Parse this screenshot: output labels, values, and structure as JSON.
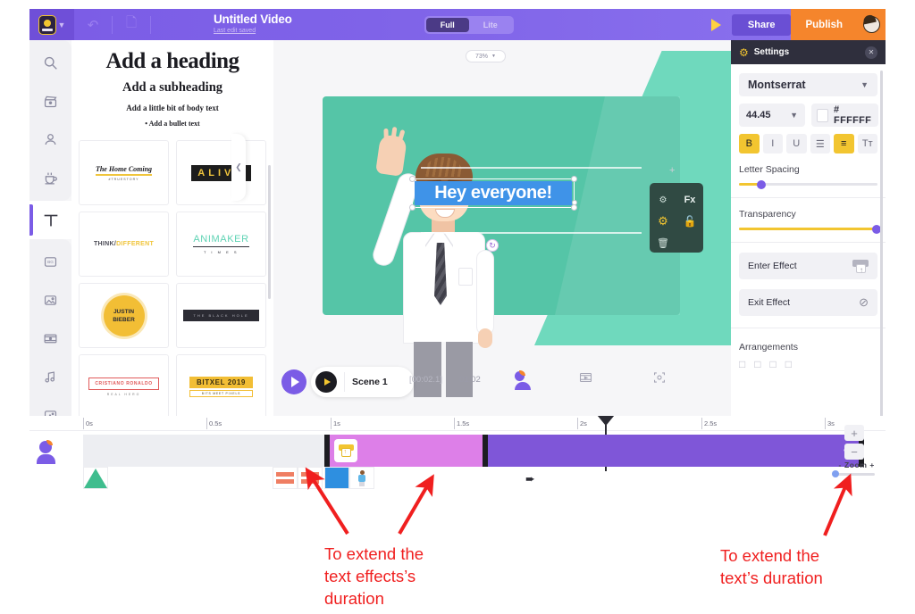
{
  "topbar": {
    "logo": "animaker-logo",
    "undo_icon": "undo-icon",
    "copy_icon": "copy-icon",
    "title": "Untitled Video",
    "subtitle": "Last edit saved",
    "mode_full": "Full",
    "mode_lite": "Lite",
    "preview_icon": "play-icon",
    "share_label": "Share",
    "publish_label": "Publish",
    "avatar": "user-avatar"
  },
  "rail": {
    "items": [
      {
        "name": "search",
        "icon": "search-icon"
      },
      {
        "name": "video",
        "icon": "clapperboard-icon"
      },
      {
        "name": "character",
        "icon": "person-icon"
      },
      {
        "name": "props",
        "icon": "props-icon"
      },
      {
        "name": "text",
        "icon": "text-t-icon",
        "active": true
      },
      {
        "name": "background",
        "icon": "bg-icon"
      },
      {
        "name": "image",
        "icon": "image-icon"
      },
      {
        "name": "video-clip",
        "icon": "film-icon"
      },
      {
        "name": "music",
        "icon": "music-note-icon"
      },
      {
        "name": "effects",
        "icon": "sparkle-icon"
      },
      {
        "name": "upload",
        "icon": "upload-icon"
      }
    ]
  },
  "text_panel": {
    "heading": "Add a heading",
    "subheading": "Add a subheading",
    "body": "Add a little bit of body text",
    "bullet": "Add a bullet text",
    "collapse_icon": "chevron-left-icon",
    "templates": [
      {
        "id": "home-coming",
        "title": "The Home Coming",
        "sub": "#TRUESTORY"
      },
      {
        "id": "alive",
        "title": "ALIVE",
        "sub": ""
      },
      {
        "id": "think-different",
        "title": "THINK/",
        "title2": "DIFFERENT",
        "sub": ""
      },
      {
        "id": "animaker-times",
        "title": "ANIMAKER",
        "sub": "T I M E S"
      },
      {
        "id": "justin-bieber",
        "title": "JUSTIN",
        "title2": "BIEBER",
        "sub": ""
      },
      {
        "id": "black-hole",
        "title": "THE BLACK HOLE",
        "sub": ""
      },
      {
        "id": "cristiano-ronaldo",
        "title": "CRISTIANO RONALDO",
        "sub": "REAL HERO"
      },
      {
        "id": "bitxel-2019",
        "title": "BITXEL 2019",
        "sub": "BITS MEET PIXELS"
      }
    ]
  },
  "stage": {
    "zoom_value": "73%",
    "zoom_caret": "chevron-down-icon",
    "text_object": "Hey everyone!",
    "rotate_icon": "rotate-icon",
    "toolbox": {
      "duplicate_icon": "duplicate-icon",
      "fx_label": "Fx",
      "settings_icon": "gear-icon",
      "lock_icon": "unlock-icon",
      "delete_icon": "trash-icon"
    }
  },
  "scenebar": {
    "play_icon": "play-icon",
    "scene_label": "Scene 1",
    "current_time": "[00:02.1]",
    "total_time": "01:02",
    "character_icon": "person-icon",
    "transition_icon": "film-icon",
    "focus_icon": "camera-focus-icon"
  },
  "settings": {
    "title": "Settings",
    "gear_icon": "gear-icon",
    "close_icon": "close-icon",
    "font_family": "Montserrat",
    "font_size": "44.45",
    "color_hex": "# FFFFFF",
    "format_buttons": [
      {
        "name": "bold",
        "glyph": "B",
        "active": true
      },
      {
        "name": "italic",
        "glyph": "I",
        "active": false
      },
      {
        "name": "underline",
        "glyph": "U",
        "active": false
      },
      {
        "name": "list",
        "glyph": "☰",
        "active": false
      },
      {
        "name": "align-center",
        "glyph": "≡",
        "active": true
      },
      {
        "name": "text-case",
        "glyph": "Tᴛ",
        "active": false
      }
    ],
    "letter_spacing_label": "Letter Spacing",
    "transparency_label": "Transparency",
    "enter_effect_label": "Enter Effect",
    "exit_effect_label": "Exit Effect",
    "exit_effect_icon": "no-effect-icon",
    "arrangements_label": "Arrangements"
  },
  "timeline": {
    "ticks": [
      "0s",
      "0.5s",
      "1s",
      "1.5s",
      "2s",
      "2.5s",
      "3s"
    ],
    "avatar_icon": "person-icon",
    "effect_icon": "enter-effect-icon",
    "collapse_icon": "chevron-left-icon",
    "zoom_in": "+",
    "zoom_out": "−",
    "zoom_label": "-  Zoom  +"
  },
  "annotations": {
    "left": "To extend the\ntext effects’s\nduration",
    "right": "To extend the\ntext’s duration",
    "color": "#f01f1f"
  }
}
